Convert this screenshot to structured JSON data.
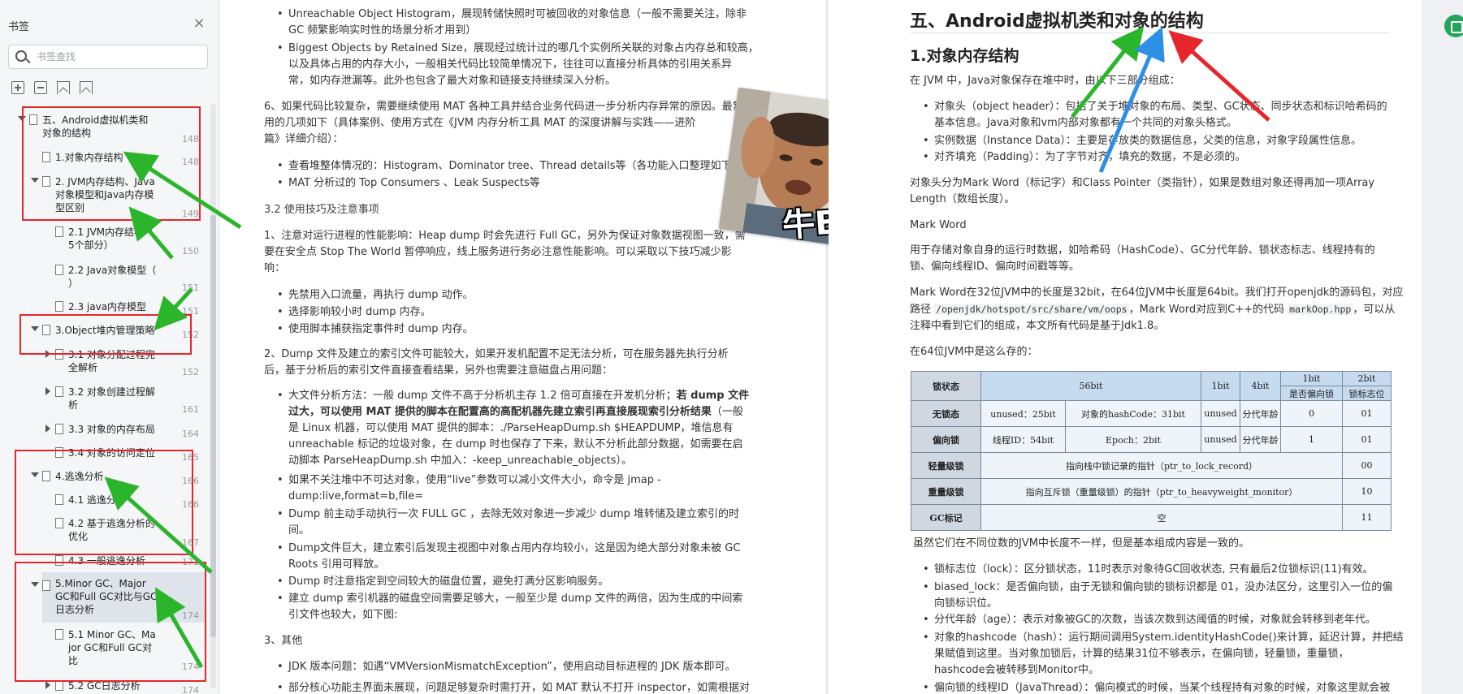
{
  "sidebar": {
    "title": "书签",
    "search_placeholder": "书签查找",
    "items": [
      {
        "label_l1": "五、Android虚拟机类和",
        "label_l2": "对象的结构",
        "page": "148"
      },
      {
        "label_l1": "1.对象内存结构",
        "page": "148"
      },
      {
        "label_l1": "2. JVM内存结构、Java",
        "label_l2": "对象模型和Java内存模",
        "label_l3": "型区别",
        "page": "149"
      },
      {
        "label_l1": "2.1 JVM内存结构（",
        "label_l2": "5个部分）",
        "page": "150"
      },
      {
        "label_l1": "2.2 Java对象模型（",
        "label_l2": "）",
        "page": "151"
      },
      {
        "label_l1": "2.3 java内存模型",
        "page": "151"
      },
      {
        "label_l1": "3.Object堆内管理策略",
        "page": "152"
      },
      {
        "label_l1": "3.1 对象分配过程完",
        "label_l2": "全解析",
        "page": "152"
      },
      {
        "label_l1": "3.2 对象创建过程解",
        "label_l2": "析",
        "page": "161"
      },
      {
        "label_l1": "3.3 对象的内存布局",
        "page": "164"
      },
      {
        "label_l1": "3.4 对象的访问定位",
        "page": "165"
      },
      {
        "label_l1": "4.逃逸分析",
        "page": "166"
      },
      {
        "label_l1": "4.1 逃逸分析",
        "page": "166"
      },
      {
        "label_l1": "4.2 基于逃逸分析的",
        "label_l2": "优化",
        "page": "167"
      },
      {
        "label_l1": "4.3 一般逃逸分析",
        "page": "171"
      },
      {
        "label_l1": "5.Minor GC、Major",
        "label_l2": "GC和Full GC对比与GC",
        "label_l3": "日志分析",
        "page": "174"
      },
      {
        "label_l1": "5.1 Minor GC、Ma",
        "label_l2": "jor GC和Full GC对",
        "label_l3": "比",
        "page": "174"
      },
      {
        "label_l1": "5.2 GC日志分析",
        "page": "174"
      }
    ]
  },
  "left": {
    "b1_l1": "Unreachable Object Histogram，展现转储快照时可被回收的对象信息（一般不需要关注，除非",
    "b1_l2": "GC 频繁影响实时性的场景分析才用到）",
    "b2_l1": "Biggest Objects by Retained Size，展现经过统计过的哪几个实例所关联的对象占内存总和较高，",
    "b2_l2": "以及具体占用的内存大小，一般相关代码比较简单情况下，往往可以直接分析具体的引用关系异",
    "b2_l3": "常，如内存泄漏等。此外也包含了最大对象和链接支持继续深入分析。",
    "p6_l1": "6、如果代码比较复杂，需要继续使用 MAT 各种工具并结合业务代码进一步分析内存异常的原因。最常",
    "p6_l2": "用的几项如下（具体案例、使用方式在《JVM 内存分析工具 MAT 的深度讲解与实践——进阶",
    "p6_l3": "篇》详细介绍）：",
    "b3": "查看堆整体情况的：Histogram、Dominator tree、Thread details等（各功能入口整理如下）",
    "b4": "MAT 分析过的 Top Consumers 、Leak Suspects等",
    "h32": "3.2 使用技巧及注意事项",
    "p1_l1": "1、注意对运行进程的性能影响：Heap dump 时会先进行 Full GC，另外为保证对象数据视图一致，需",
    "p1_l2": "要在安全点 Stop The World 暂停响应，线上服务进行务必注意性能影响。可以采取以下技巧减少影",
    "p1_l3": "响：",
    "b5": "先禁用入口流量，再执行 dump 动作。",
    "b6": "选择影响较小时 dump 内存。",
    "b7": "使用脚本捕获指定事件时 dump 内存。",
    "p2_l1": "2、Dump 文件及建立的索引文件可能较大，如果开发机配置不足无法分析，可在服务器先执行分析",
    "p2_l2": "后，基于分析后的索引文件直接查看结果，另外也需要注意磁盘占用问题：",
    "b8_l1a": "大文件分析方法：一般 dump 文件不高于分析机主存 1.2 倍可直接在开发机分析；",
    "b8_l1b": "若 dump 文件",
    "b8_l2a": "过大，可以使用 MAT 提供的脚本在配置高的高配机器先建立索引再直接展现索引分析结果",
    "b8_l2b": "（一般",
    "b8_l3": "是 Linux 机器，可以使用 MAT 提供的脚本：./ParseHeapDump.sh $HEAPDUMP，堆信息有",
    "b8_l4": "unreachable 标记的垃圾对象，在 dump 时也保存了下来，默认不分析此部分数据，如需要在启",
    "b8_l5": "动脚本 ParseHeapDump.sh 中加入：-keep_unreachable_objects）。",
    "b9_l1": "如果不关注堆中不可达对象，使用“live”参数可以减小文件大小，命令是 jmap -",
    "b9_l2": "dump:live,format=b,file=",
    "b10_l1": "Dump 前主动手动执行一次 FULL GC ，去除无效对象进一步减少 dump 堆转储及建立索引的时",
    "b10_l2": "间。",
    "b11_l1": "Dump文件巨大，建立索引后发现主视图中对象占用内存均较小，这是因为绝大部分对象未被 GC",
    "b11_l2": "Roots 引用可释放。",
    "b12": "Dump 时注意指定到空间较大的磁盘位置，避免打满分区影响服务。",
    "b13_l1": "建立 dump 索引机器的磁盘空间需要足够大，一般至少是 dump 文件的两倍，因为生成的中间索",
    "b13_l2": "引文件也较大，如下图:",
    "p3": "3、其他",
    "b14": "JDK 版本问题：如遇“VMVersionMismatchException”，使用启动目标进程的 JDK 版本即可。",
    "b15": "部分核心功能主界面未展现，问题足够复杂时需打开，如 MAT 默认不打开 inspector，如需根据对",
    "meme_caption": "牛B"
  },
  "right": {
    "h1": "五、Android虚拟机类和对象的结构",
    "h2": "1.对象内存结构",
    "intro": "在 JVM 中，Java对象保存在堆中时，由以下三部分组成：",
    "r1_l1": "对象头（object header）：包括了关于堆对象的布局、类型、GC状态、同步状态和标识哈希码的",
    "r1_l2": "基本信息。Java对象和vm内部对象都有一个共同的对象头格式。",
    "r2": "实例数据（Instance Data）：主要是存放类的数据信息，父类的信息，对象字段属性信息。",
    "r3": "对齐填充（Padding）：为了字节对齐，填充的数据，不是必须的。",
    "p_split_l1": "对象头分为Mark Word（标记字）和Class Pointer（类指针），如果是数组对象还得再加一项Array",
    "p_split_l2": "Length（数组长度）。",
    "mw_title": "Mark Word",
    "mw_desc_l1": "用于存储对象自身的运行时数据，如哈希码（HashCode）、GC分代年龄、锁状态标志、线程持有的",
    "mw_desc_l2": "锁、偏向线程ID、偏向时间戳等等。",
    "mw_len_l1a": "Mark Word在32位JVM中的长度是32bit，在64位JVM中长度是64bit。我们打开openjdk的源码包，对应",
    "mw_len_l2a": "路径",
    "mw_path": "/openjdk/hotspot/src/share/vm/oops",
    "mw_len_l2b": "，Mark Word对应到C++的代码",
    "mw_file": "markOop.hpp",
    "mw_len_l2c": "，可以从",
    "mw_len_l3": "注释中看到它们的组成，本文所有代码是基于Jdk1.8。",
    "in64": "在64位JVM中是这么存的：",
    "after_table": "虽然它们在不同位数的JVM中长度不一样，但是基本组成内容是一致的。",
    "s1": "锁标志位（lock）：区分锁状态，11时表示对象待GC回收状态, 只有最后2位锁标识(11)有效。",
    "s2_l1": "biased_lock：是否偏向锁，由于无锁和偏向锁的锁标识都是 01，没办法区分，这里引入一位的偏",
    "s2_l2": "向锁标识位。",
    "s3": "分代年龄（age）：表示对象被GC的次数，当该次数到达阈值的时候，对象就会转移到老年代。",
    "s4_l1": "对象的hashcode（hash）：运行期间调用System.identityHashCode()来计算，延迟计算，并把结",
    "s4_l2": "果赋值到这里。当对象加锁后，计算的结果31位不够表示，在偏向锁，轻量锁，重量锁，",
    "s4_l3": "hashcode会被转移到Monitor中。",
    "s5": "偏向锁的线程ID（JavaThread）：偏向模式的时候，当某个线程持有对象的时候，对象这里就会被"
  },
  "table": {
    "h_state": "锁状态",
    "h_56": "56bit",
    "h_1a": "1bit",
    "h_4": "4bit",
    "h_1b": "1bit",
    "h_2": "2bit",
    "h_biased": "是否偏向锁",
    "h_flag": "锁标志位",
    "r_nolock": "无锁态",
    "c_unused25": "unused：25bit",
    "c_hash31": "对象的hashCode：31bit",
    "c_unused": "unused",
    "c_age": "分代年龄",
    "c_0": "0",
    "c_01": "01",
    "r_biased": "偏向锁",
    "c_thread54": "线程ID：54bit",
    "c_epoch": "Epoch：2bit",
    "c_1": "1",
    "r_light": "轻量级锁",
    "c_light_ptr": "指向栈中锁记录的指针（ptr_to_lock_record）",
    "c_00": "00",
    "r_heavy": "重量级锁",
    "c_heavy_ptr": "指向互斥锁（重量级锁）的指针（ptr_to_heavyweight_monitor）",
    "c_10": "10",
    "r_gc": "GC标记",
    "c_empty": "空",
    "c_11": "11"
  }
}
